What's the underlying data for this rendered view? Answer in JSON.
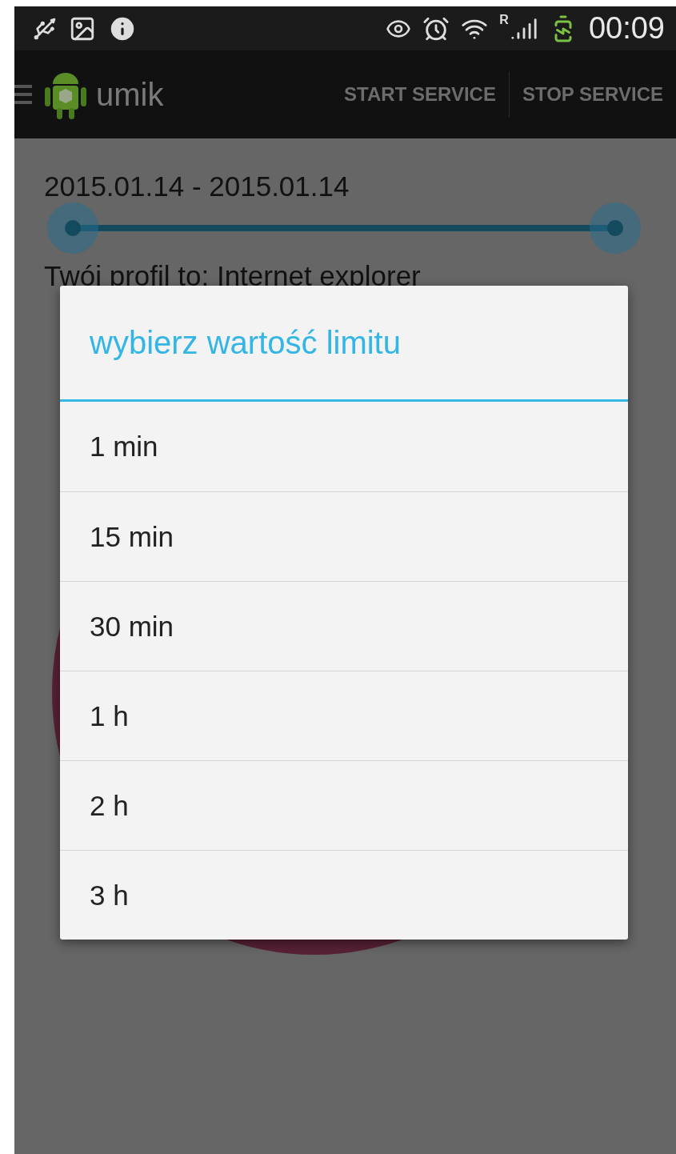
{
  "status_bar": {
    "time": "00:09",
    "roaming": "R"
  },
  "action_bar": {
    "title": "umik",
    "actions": [
      "START SERVICE",
      "STOP SERVICE"
    ]
  },
  "content": {
    "date_range": "2015.01.14 - 2015.01.14",
    "range_slider": {
      "start": {
        "level": 0
      },
      "end": {
        "level": 1
      }
    },
    "profile_text": "Twój profil to: Internet explorer"
  },
  "dialog": {
    "title": "wybierz wartość limitu",
    "options": [
      {
        "label": "1 min"
      },
      {
        "label": "15 min"
      },
      {
        "label": "30 min"
      },
      {
        "label": "1 h"
      },
      {
        "label": "2 h"
      },
      {
        "label": "3 h"
      }
    ]
  }
}
